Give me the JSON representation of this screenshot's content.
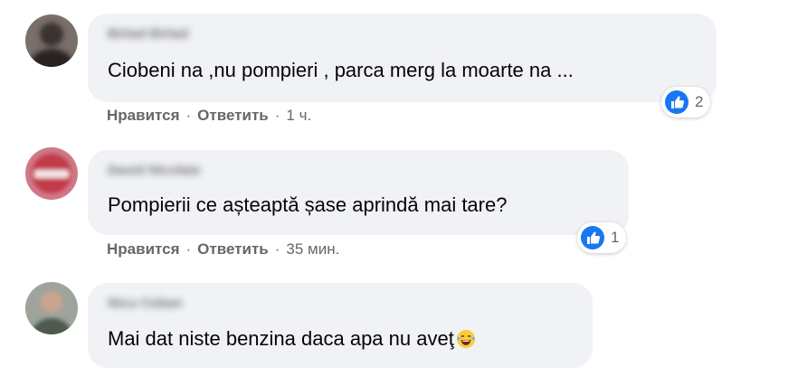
{
  "comments": [
    {
      "author": "Birlad Birlad",
      "text": "Ciobeni na ,nu pompieri , parca merg la moarte na ...",
      "like": "Нравится",
      "reply": "Ответить",
      "time": "1 ч.",
      "reactions": "2",
      "avatar_color": "#4a4040"
    },
    {
      "author": "David Nicolaie",
      "text": "Pompierii ce așteaptă șase aprindă mai tare?",
      "like": "Нравится",
      "reply": "Ответить",
      "time": "35 мин.",
      "reactions": "1",
      "avatar_color": "#c0404a"
    },
    {
      "author": "Nicu Ceban",
      "text": "Mai dat niste benzina daca apa nu aveţ",
      "emoji": "face-with-tears-of-joy",
      "avatar_color": "#6e746c"
    }
  ],
  "separator": "·",
  "colors": {
    "bubble": "#f0f2f5",
    "secondary_text": "#65676b",
    "like_blue": "#1877f2"
  }
}
